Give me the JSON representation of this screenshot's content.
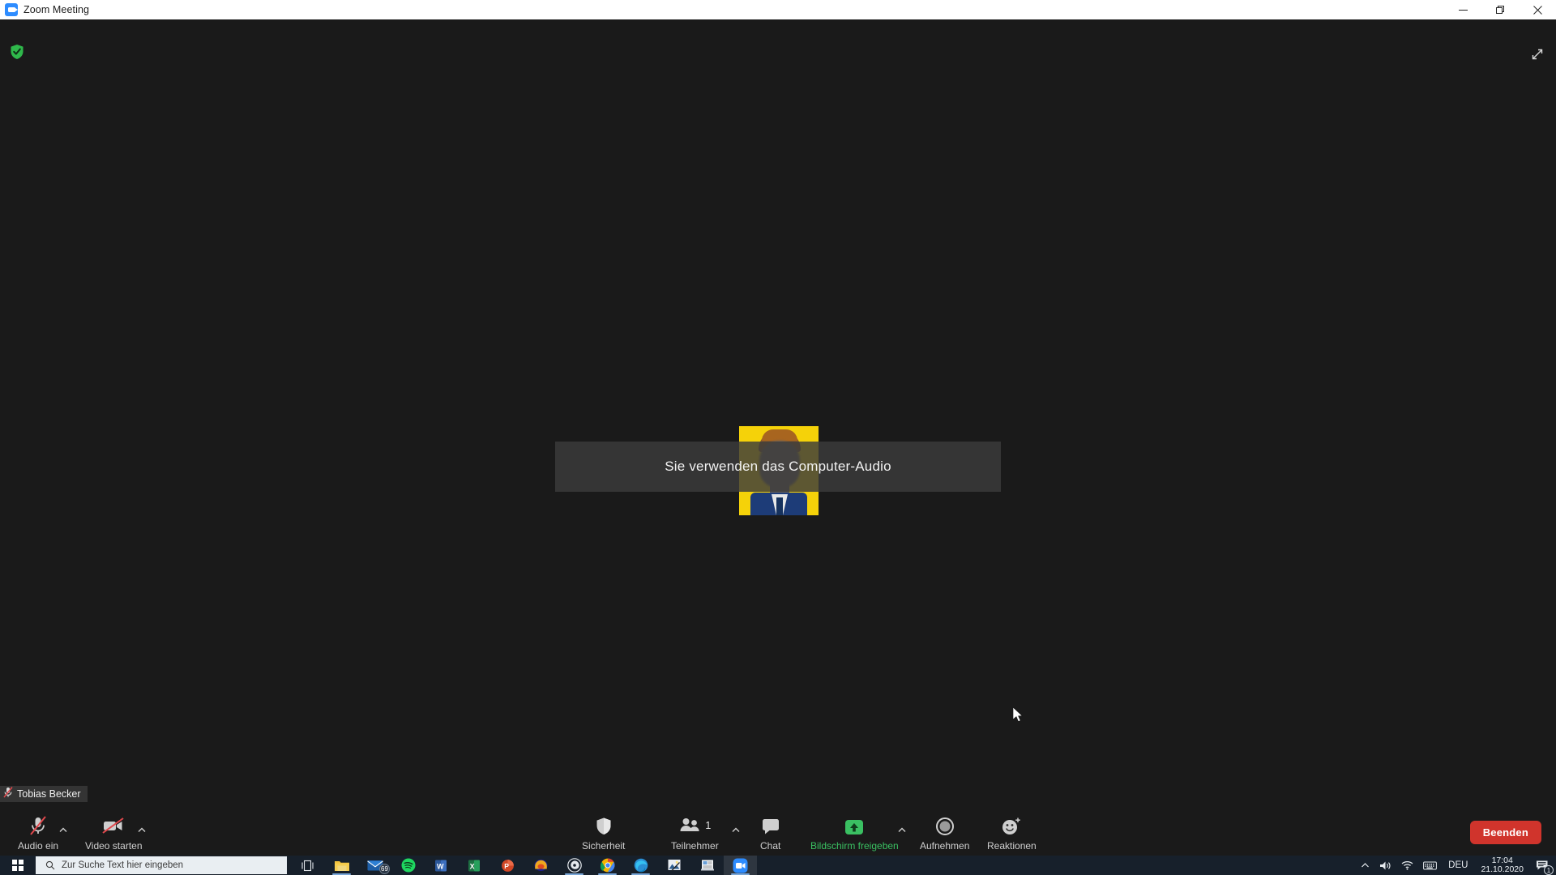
{
  "window": {
    "title": "Zoom Meeting",
    "icon": "zoom-camera-icon",
    "controls": {
      "minimize": "minimize-icon",
      "restore": "restore-icon",
      "close": "close-icon"
    }
  },
  "meeting": {
    "encryption_icon": "green-shield-check-icon",
    "fullscreen_icon": "expand-diagonal-icon",
    "toast_message": "Sie verwenden das Computer-Audio",
    "self_name": "Tobias Becker",
    "self_name_icon": "muted-mic-icon",
    "avatar_alt": "participant-avatar-photo"
  },
  "toolbar": {
    "audio": {
      "label": "Audio ein",
      "icon": "mic-muted-icon",
      "caret": "chevron-up-icon"
    },
    "video": {
      "label": "Video starten",
      "icon": "camera-muted-icon",
      "caret": "chevron-up-icon"
    },
    "security": {
      "label": "Sicherheit",
      "icon": "shield-icon"
    },
    "participants": {
      "label": "Teilnehmer",
      "icon": "people-icon",
      "count": "1",
      "caret": "chevron-up-icon"
    },
    "chat": {
      "label": "Chat",
      "icon": "speech-bubble-icon"
    },
    "share": {
      "label": "Bildschirm freigeben",
      "icon": "share-screen-arrow-icon",
      "caret": "chevron-up-icon",
      "color": "#3ac062"
    },
    "record": {
      "label": "Aufnehmen",
      "icon": "record-circle-icon"
    },
    "reactions": {
      "label": "Reaktionen",
      "icon": "smiley-plus-icon"
    },
    "end": {
      "label": "Beenden",
      "color": "#d0342c"
    }
  },
  "taskbar": {
    "start_icon": "windows-logo-icon",
    "search_placeholder": "Zur Suche Text hier eingeben",
    "search_icon": "search-icon",
    "apps": [
      {
        "name": "task-view-icon",
        "running": false
      },
      {
        "name": "file-explorer-icon",
        "running": true
      },
      {
        "name": "mail-icon",
        "running": false,
        "badge": "69"
      },
      {
        "name": "spotify-icon",
        "running": false
      },
      {
        "name": "word-icon",
        "running": false
      },
      {
        "name": "excel-icon",
        "running": false
      },
      {
        "name": "powerpoint-icon",
        "running": false
      },
      {
        "name": "discord-icon",
        "running": false
      },
      {
        "name": "obs-studio-icon",
        "running": true
      },
      {
        "name": "chrome-icon",
        "running": true
      },
      {
        "name": "edge-icon",
        "running": true
      },
      {
        "name": "photo-editor-icon",
        "running": false
      },
      {
        "name": "document-app-icon",
        "running": false
      },
      {
        "name": "zoom-icon",
        "running": true,
        "active": true
      }
    ],
    "tray": {
      "overflow_icon": "chevron-up-icon",
      "volume_icon": "speaker-icon",
      "network_icon": "wifi-icon",
      "keyboard_icon": "keyboard-icon",
      "language": "DEU",
      "time": "17:04",
      "date": "21.10.2020",
      "notifications_icon": "notification-icon",
      "notifications_count": "1"
    }
  }
}
